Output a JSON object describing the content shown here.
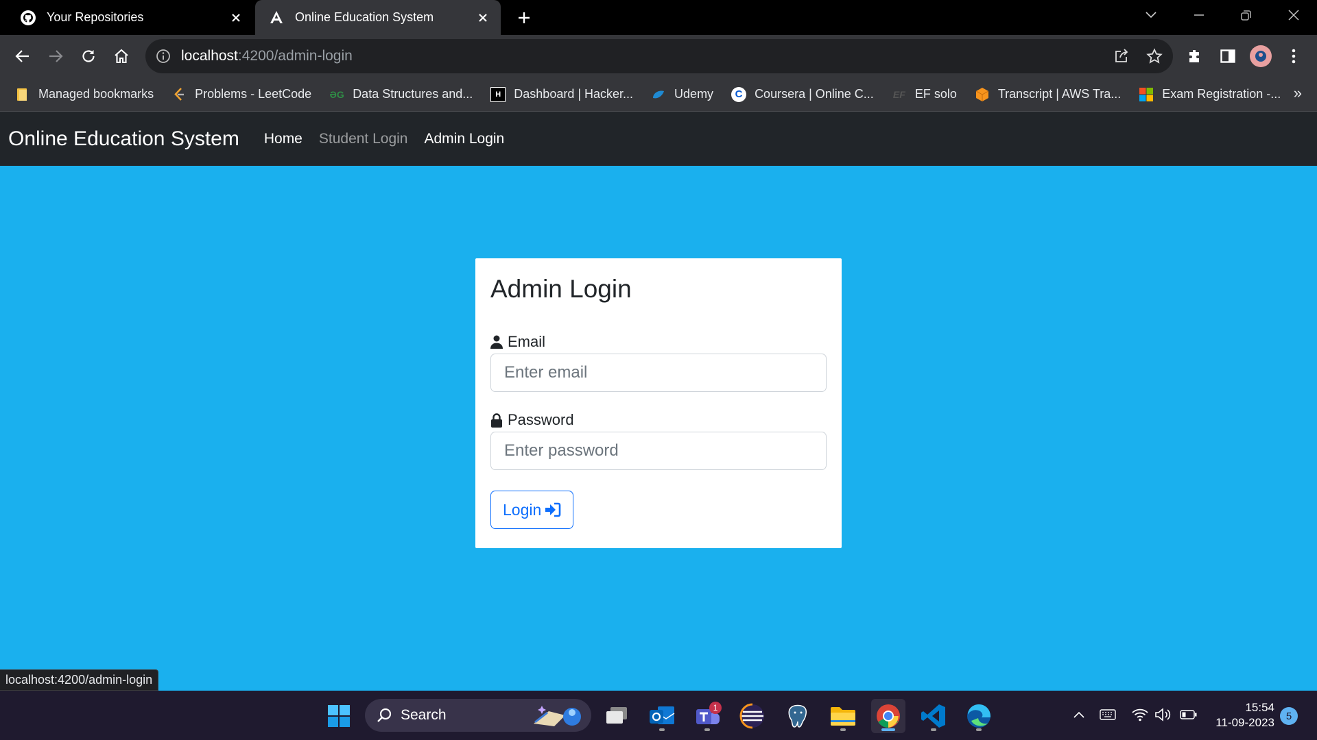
{
  "browser": {
    "tabs": [
      {
        "title": "Your Repositories",
        "icon": "github-icon",
        "active": false
      },
      {
        "title": "Online Education System",
        "icon": "angular-icon",
        "active": true
      }
    ],
    "address": {
      "host": "localhost",
      "path": ":4200/admin-login"
    },
    "bookmarks": [
      {
        "label": "Managed bookmarks",
        "icon": "folder-icon"
      },
      {
        "label": "Problems - LeetCode",
        "icon": "leetcode-icon"
      },
      {
        "label": "Data Structures and...",
        "icon": "geeksforgeeks-icon"
      },
      {
        "label": "Dashboard | Hacker...",
        "icon": "hackerrank-icon"
      },
      {
        "label": "Udemy",
        "icon": "udemy-icon"
      },
      {
        "label": "Coursera | Online C...",
        "icon": "coursera-icon"
      },
      {
        "label": "EF solo",
        "icon": "ef-icon"
      },
      {
        "label": "Transcript | AWS Tra...",
        "icon": "aws-icon"
      },
      {
        "label": "Exam Registration -...",
        "icon": "microsoft-icon"
      }
    ],
    "bookmarks_overflow": "»",
    "status_url": "localhost:4200/admin-login"
  },
  "app": {
    "brand": "Online Education System",
    "nav": [
      {
        "label": "Home",
        "active": true
      },
      {
        "label": "Student Login",
        "active": false
      },
      {
        "label": "Admin Login",
        "active": true
      }
    ],
    "login": {
      "title": "Admin Login",
      "email_label": "Email",
      "email_placeholder": "Enter email",
      "password_label": "Password",
      "password_placeholder": "Enter password",
      "button_label": "Login"
    }
  },
  "taskbar": {
    "search_label": "Search",
    "teams_badge": "1",
    "time": "15:54",
    "date": "11-09-2023",
    "notifications": "5"
  },
  "colors": {
    "page_background": "#1ab0ee",
    "navbar": "#212529",
    "primary": "#0d6efd"
  }
}
